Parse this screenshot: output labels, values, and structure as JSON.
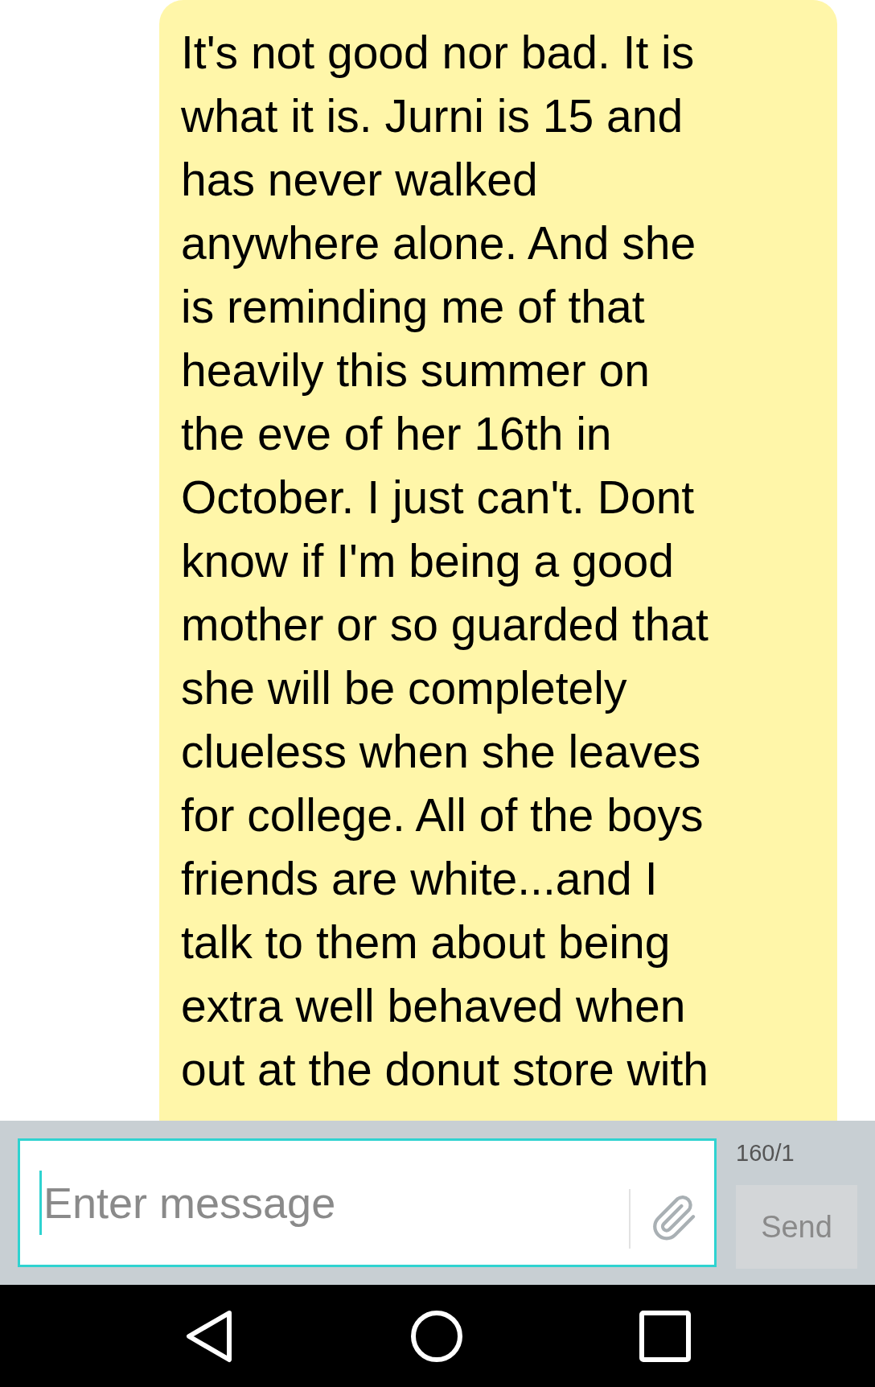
{
  "message": {
    "text": "It's not good nor bad. It is\nwhat it is. Jurni is 15 and\nhas never walked\nanywhere alone. And she\nis reminding me of that\nheavily this summer on\nthe eve of her 16th in\nOctober. I just can't. Dont\nknow if I'm being a good\nmother or so guarded that\nshe will be completely\nclueless when she leaves\nfor college. All of the boys\nfriends are white...and I\ntalk to them about being\nextra well behaved when\nout at the donut store with"
  },
  "composer": {
    "placeholder": "Enter message",
    "counter": "160/1",
    "send_label": "Send",
    "send_disabled": true
  }
}
